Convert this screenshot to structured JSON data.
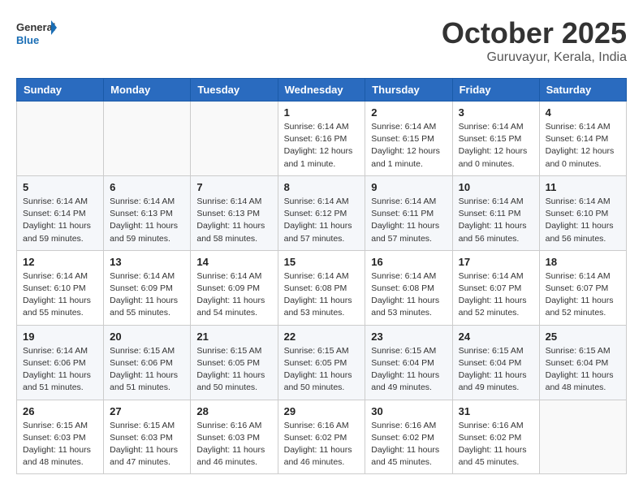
{
  "header": {
    "logo_line1": "General",
    "logo_line2": "Blue",
    "month": "October 2025",
    "location": "Guruvayur, Kerala, India"
  },
  "days_of_week": [
    "Sunday",
    "Monday",
    "Tuesday",
    "Wednesday",
    "Thursday",
    "Friday",
    "Saturday"
  ],
  "weeks": [
    [
      {
        "day": "",
        "info": ""
      },
      {
        "day": "",
        "info": ""
      },
      {
        "day": "",
        "info": ""
      },
      {
        "day": "1",
        "info": "Sunrise: 6:14 AM\nSunset: 6:16 PM\nDaylight: 12 hours\nand 1 minute."
      },
      {
        "day": "2",
        "info": "Sunrise: 6:14 AM\nSunset: 6:15 PM\nDaylight: 12 hours\nand 1 minute."
      },
      {
        "day": "3",
        "info": "Sunrise: 6:14 AM\nSunset: 6:15 PM\nDaylight: 12 hours\nand 0 minutes."
      },
      {
        "day": "4",
        "info": "Sunrise: 6:14 AM\nSunset: 6:14 PM\nDaylight: 12 hours\nand 0 minutes."
      }
    ],
    [
      {
        "day": "5",
        "info": "Sunrise: 6:14 AM\nSunset: 6:14 PM\nDaylight: 11 hours\nand 59 minutes."
      },
      {
        "day": "6",
        "info": "Sunrise: 6:14 AM\nSunset: 6:13 PM\nDaylight: 11 hours\nand 59 minutes."
      },
      {
        "day": "7",
        "info": "Sunrise: 6:14 AM\nSunset: 6:13 PM\nDaylight: 11 hours\nand 58 minutes."
      },
      {
        "day": "8",
        "info": "Sunrise: 6:14 AM\nSunset: 6:12 PM\nDaylight: 11 hours\nand 57 minutes."
      },
      {
        "day": "9",
        "info": "Sunrise: 6:14 AM\nSunset: 6:11 PM\nDaylight: 11 hours\nand 57 minutes."
      },
      {
        "day": "10",
        "info": "Sunrise: 6:14 AM\nSunset: 6:11 PM\nDaylight: 11 hours\nand 56 minutes."
      },
      {
        "day": "11",
        "info": "Sunrise: 6:14 AM\nSunset: 6:10 PM\nDaylight: 11 hours\nand 56 minutes."
      }
    ],
    [
      {
        "day": "12",
        "info": "Sunrise: 6:14 AM\nSunset: 6:10 PM\nDaylight: 11 hours\nand 55 minutes."
      },
      {
        "day": "13",
        "info": "Sunrise: 6:14 AM\nSunset: 6:09 PM\nDaylight: 11 hours\nand 55 minutes."
      },
      {
        "day": "14",
        "info": "Sunrise: 6:14 AM\nSunset: 6:09 PM\nDaylight: 11 hours\nand 54 minutes."
      },
      {
        "day": "15",
        "info": "Sunrise: 6:14 AM\nSunset: 6:08 PM\nDaylight: 11 hours\nand 53 minutes."
      },
      {
        "day": "16",
        "info": "Sunrise: 6:14 AM\nSunset: 6:08 PM\nDaylight: 11 hours\nand 53 minutes."
      },
      {
        "day": "17",
        "info": "Sunrise: 6:14 AM\nSunset: 6:07 PM\nDaylight: 11 hours\nand 52 minutes."
      },
      {
        "day": "18",
        "info": "Sunrise: 6:14 AM\nSunset: 6:07 PM\nDaylight: 11 hours\nand 52 minutes."
      }
    ],
    [
      {
        "day": "19",
        "info": "Sunrise: 6:14 AM\nSunset: 6:06 PM\nDaylight: 11 hours\nand 51 minutes."
      },
      {
        "day": "20",
        "info": "Sunrise: 6:15 AM\nSunset: 6:06 PM\nDaylight: 11 hours\nand 51 minutes."
      },
      {
        "day": "21",
        "info": "Sunrise: 6:15 AM\nSunset: 6:05 PM\nDaylight: 11 hours\nand 50 minutes."
      },
      {
        "day": "22",
        "info": "Sunrise: 6:15 AM\nSunset: 6:05 PM\nDaylight: 11 hours\nand 50 minutes."
      },
      {
        "day": "23",
        "info": "Sunrise: 6:15 AM\nSunset: 6:04 PM\nDaylight: 11 hours\nand 49 minutes."
      },
      {
        "day": "24",
        "info": "Sunrise: 6:15 AM\nSunset: 6:04 PM\nDaylight: 11 hours\nand 49 minutes."
      },
      {
        "day": "25",
        "info": "Sunrise: 6:15 AM\nSunset: 6:04 PM\nDaylight: 11 hours\nand 48 minutes."
      }
    ],
    [
      {
        "day": "26",
        "info": "Sunrise: 6:15 AM\nSunset: 6:03 PM\nDaylight: 11 hours\nand 48 minutes."
      },
      {
        "day": "27",
        "info": "Sunrise: 6:15 AM\nSunset: 6:03 PM\nDaylight: 11 hours\nand 47 minutes."
      },
      {
        "day": "28",
        "info": "Sunrise: 6:16 AM\nSunset: 6:03 PM\nDaylight: 11 hours\nand 46 minutes."
      },
      {
        "day": "29",
        "info": "Sunrise: 6:16 AM\nSunset: 6:02 PM\nDaylight: 11 hours\nand 46 minutes."
      },
      {
        "day": "30",
        "info": "Sunrise: 6:16 AM\nSunset: 6:02 PM\nDaylight: 11 hours\nand 45 minutes."
      },
      {
        "day": "31",
        "info": "Sunrise: 6:16 AM\nSunset: 6:02 PM\nDaylight: 11 hours\nand 45 minutes."
      },
      {
        "day": "",
        "info": ""
      }
    ]
  ]
}
